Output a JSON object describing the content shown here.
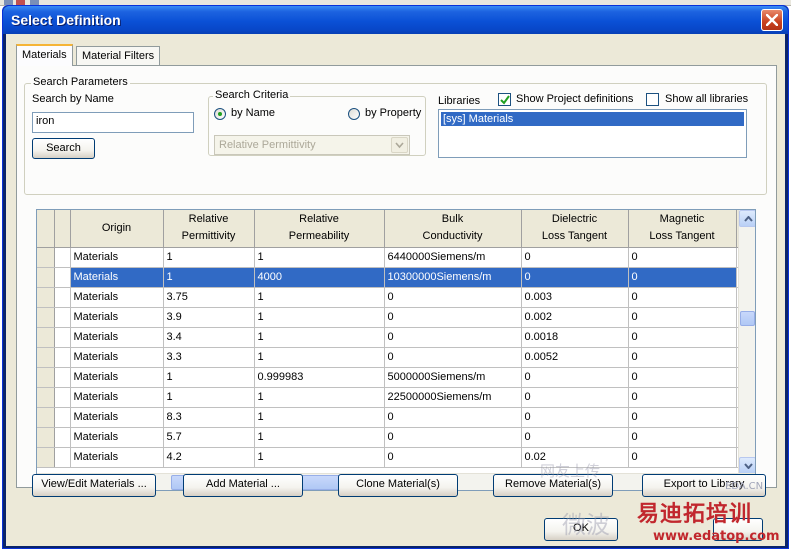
{
  "window": {
    "title": "Select Definition"
  },
  "tabs": [
    {
      "label": "Materials",
      "active": true
    },
    {
      "label": "Material Filters",
      "active": false
    }
  ],
  "search_parameters": {
    "legend": "Search Parameters",
    "by_name_label": "Search by Name",
    "name_value": "iron",
    "search_button": "Search"
  },
  "search_criteria": {
    "legend": "Search Criteria",
    "by_name": "by Name",
    "by_property": "by Property",
    "selected": "by Name",
    "property_combo_value": "Relative Permittivity"
  },
  "libraries": {
    "label": "Libraries",
    "show_project_definitions": "Show Project definitions",
    "show_project_checked": true,
    "show_all_libraries": "Show all libraries",
    "show_all_checked": false,
    "items": [
      "[sys] Materials"
    ]
  },
  "table": {
    "columns": [
      "Origin",
      "Relative\nPermittivity",
      "Relative\nPermeability",
      "Bulk\nConductivity",
      "Dielectric\nLoss Tangent",
      "Magnetic\nLoss Tangent"
    ],
    "selected_row": 1,
    "rows": [
      [
        "Materials",
        "1",
        "1",
        "6440000Siemens/m",
        "0",
        "0"
      ],
      [
        "Materials",
        "1",
        "4000",
        "10300000Siemens/m",
        "0",
        "0"
      ],
      [
        "Materials",
        "3.75",
        "1",
        "0",
        "0.003",
        "0"
      ],
      [
        "Materials",
        "3.9",
        "1",
        "0",
        "0.002",
        "0"
      ],
      [
        "Materials",
        "3.4",
        "1",
        "0",
        "0.0018",
        "0"
      ],
      [
        "Materials",
        "3.3",
        "1",
        "0",
        "0.0052",
        "0"
      ],
      [
        "Materials",
        "1",
        "0.999983",
        "5000000Siemens/m",
        "0",
        "0"
      ],
      [
        "Materials",
        "1",
        "1",
        "22500000Siemens/m",
        "0",
        "0"
      ],
      [
        "Materials",
        "8.3",
        "1",
        "0",
        "0",
        "0"
      ],
      [
        "Materials",
        "5.7",
        "1",
        "0",
        "0",
        "0"
      ],
      [
        "Materials",
        "4.2",
        "1",
        "0",
        "0.02",
        "0"
      ]
    ]
  },
  "buttons": {
    "view_edit": "View/Edit Materials ...",
    "add": "Add Material ...",
    "clone": "Clone Material(s)",
    "remove": "Remove Material(s)",
    "export": "Export to Library",
    "ok": "OK"
  },
  "watermark": {
    "logo": "易迪拓培训",
    "url": "www.edatop.com",
    "small": "EDA.CN"
  }
}
